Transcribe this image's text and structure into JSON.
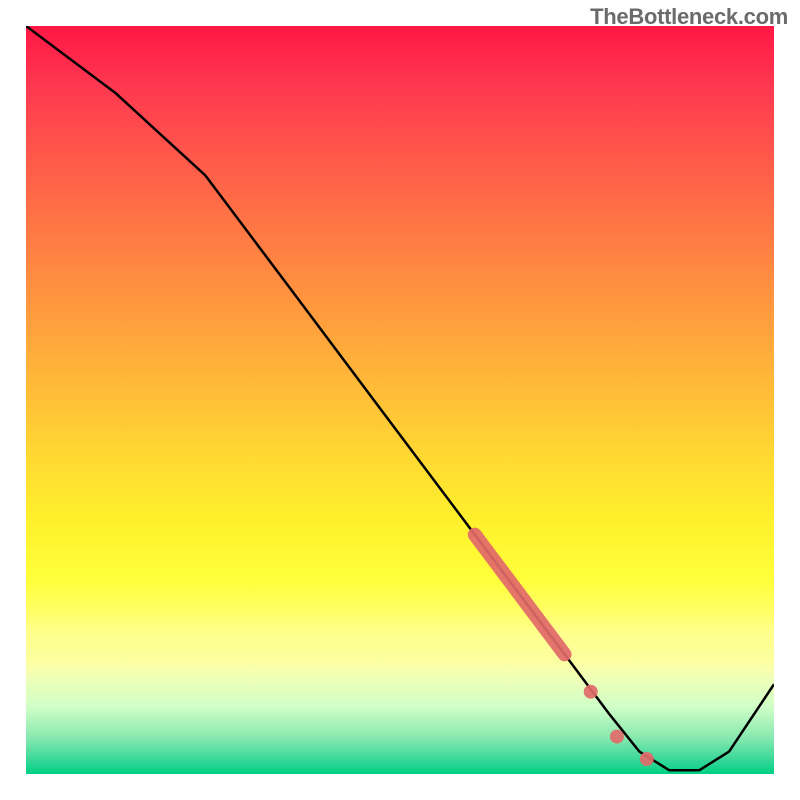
{
  "watermark": "TheBottleneck.com",
  "chart_data": {
    "type": "line",
    "title": "",
    "xlabel": "",
    "ylabel": "",
    "xlim": [
      0,
      100
    ],
    "ylim": [
      0,
      100
    ],
    "series": [
      {
        "name": "curve",
        "x": [
          0,
          12,
          24,
          36,
          48,
          60,
          66,
          72,
          78,
          82,
          86,
          90,
          94,
          100
        ],
        "values": [
          100,
          91,
          80,
          64,
          48,
          32,
          24,
          16,
          8,
          3,
          0.5,
          0.5,
          3,
          12
        ]
      }
    ],
    "markers": [
      {
        "kind": "segment",
        "x0": 60,
        "y0": 32,
        "x1": 72,
        "y1": 16,
        "weight": "thick"
      },
      {
        "kind": "point",
        "x": 75.5,
        "y": 11
      },
      {
        "kind": "point",
        "x": 79.0,
        "y": 5
      },
      {
        "kind": "point",
        "x": 83.0,
        "y": 2
      }
    ],
    "colors": {
      "curve": "#000000",
      "markers": "#e26a6a",
      "gradient_top": "#ff1744",
      "gradient_bottom": "#00d084"
    }
  }
}
